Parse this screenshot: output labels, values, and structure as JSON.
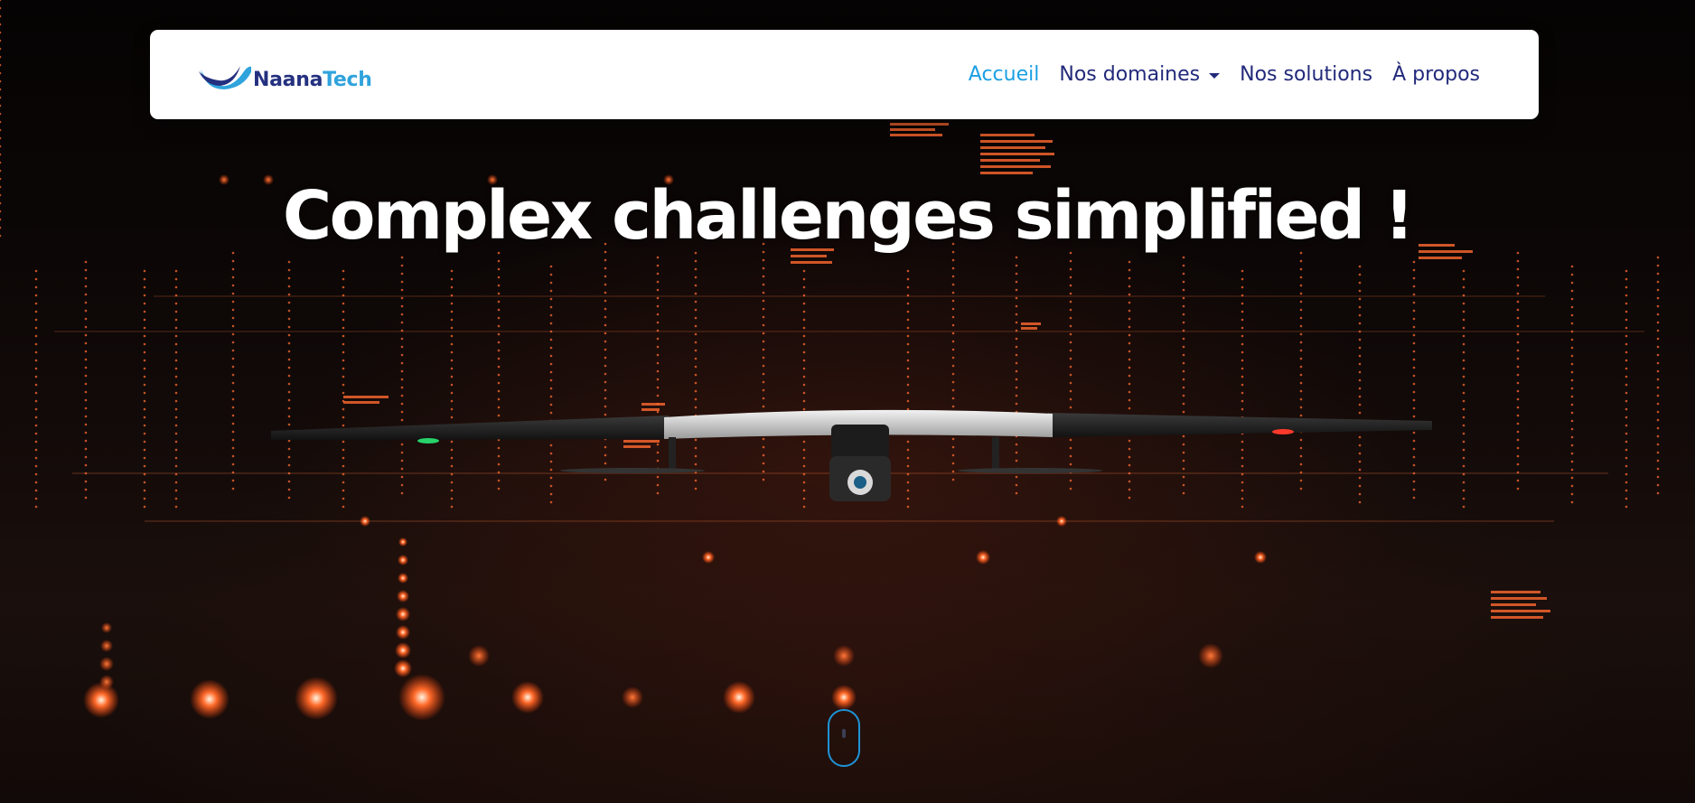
{
  "brand": {
    "name_part1": "Naana",
    "name_part2": "Tech",
    "primary_color": "#24307f",
    "accent_color": "#2fa3dc",
    "logo_icon": "wave-logo-icon"
  },
  "nav": {
    "items": [
      {
        "label": "Accueil",
        "active": true
      },
      {
        "label": "Nos domaines",
        "dropdown": true
      },
      {
        "label": "Nos solutions"
      },
      {
        "label": "À propos"
      }
    ],
    "active_color": "#1ba0e3",
    "link_color": "#222a7a"
  },
  "hero": {
    "headline": "Complex challenges simplified !",
    "background": "drone-over-orange-data-grid",
    "scroll_icon": "mouse-scroll-icon",
    "scroll_color": "#1e93d6"
  }
}
